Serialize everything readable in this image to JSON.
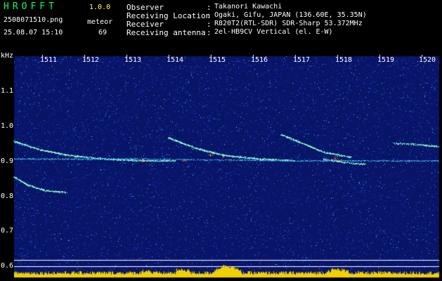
{
  "header": {
    "app_title": "HROFFT",
    "version": "1.0.0",
    "filename": "2508071510.png",
    "datetime": "25.08.07 15:10",
    "mode_label": "meteor",
    "count": "69"
  },
  "info": [
    {
      "label": "Observer",
      "sep": ":",
      "value": "Takanori Kawachi"
    },
    {
      "label": "Receiving Location",
      "sep": ":",
      "value": "Ogaki, Gifu, JAPAN (136.60E, 35.35N)"
    },
    {
      "label": "Receiver",
      "sep": ":",
      "value": "R820T2(RTL-SDR) SDR-Sharp 53.372MHz"
    },
    {
      "label": "Receiving antenna",
      "sep": ":",
      "value": "2el-HB9CV Vertical (el. E-W)"
    }
  ],
  "axis": {
    "y_unit": "kHz",
    "y_ticks": [
      "1.1",
      "1.0",
      "0.9",
      "0.8",
      "0.7",
      "0.6"
    ],
    "x_ticks": [
      "1511",
      "1512",
      "1513",
      "1514",
      "1515",
      "1516",
      "1517",
      "1518",
      "1519",
      "1520"
    ]
  },
  "colors": {
    "background": "#000000",
    "noise_field": "#0a1a7a",
    "title_green": "#00ff66",
    "version_yellow": "#ffff66",
    "trace": "#7cf4d0",
    "hot": "#ff4040",
    "power_bar": "#f0d000",
    "reference_line": "#ffffff"
  }
}
